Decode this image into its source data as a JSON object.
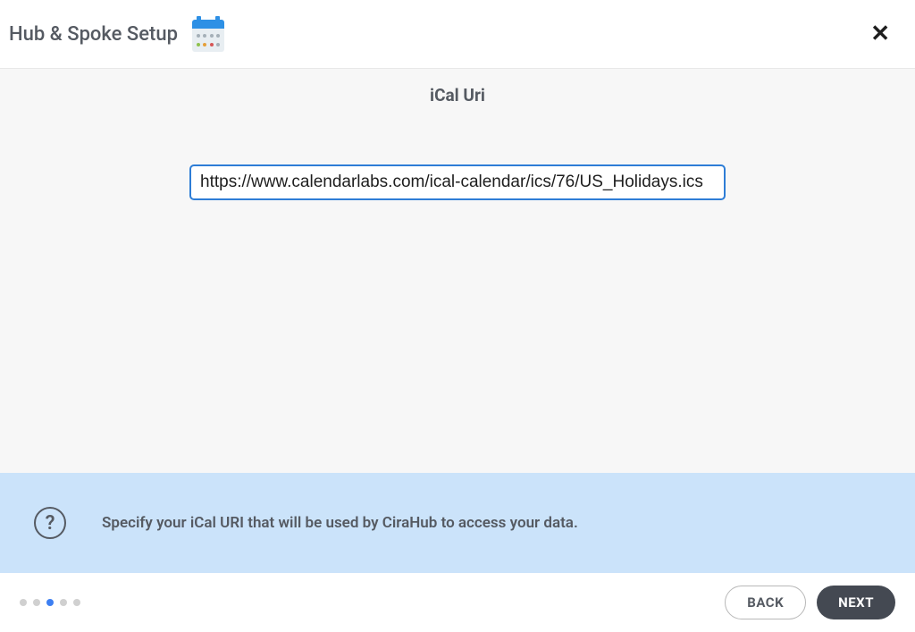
{
  "header": {
    "title": "Hub & Spoke Setup"
  },
  "main": {
    "section_title": "iCal Uri",
    "input_value": "https://www.calendarlabs.com/ical-calendar/ics/76/US_Holidays.ics"
  },
  "helper": {
    "text": "Specify your iCal URI that will be used by CiraHub to access your data."
  },
  "footer": {
    "back_label": "BACK",
    "next_label": "NEXT",
    "progress_total": 5,
    "progress_active": 2
  }
}
